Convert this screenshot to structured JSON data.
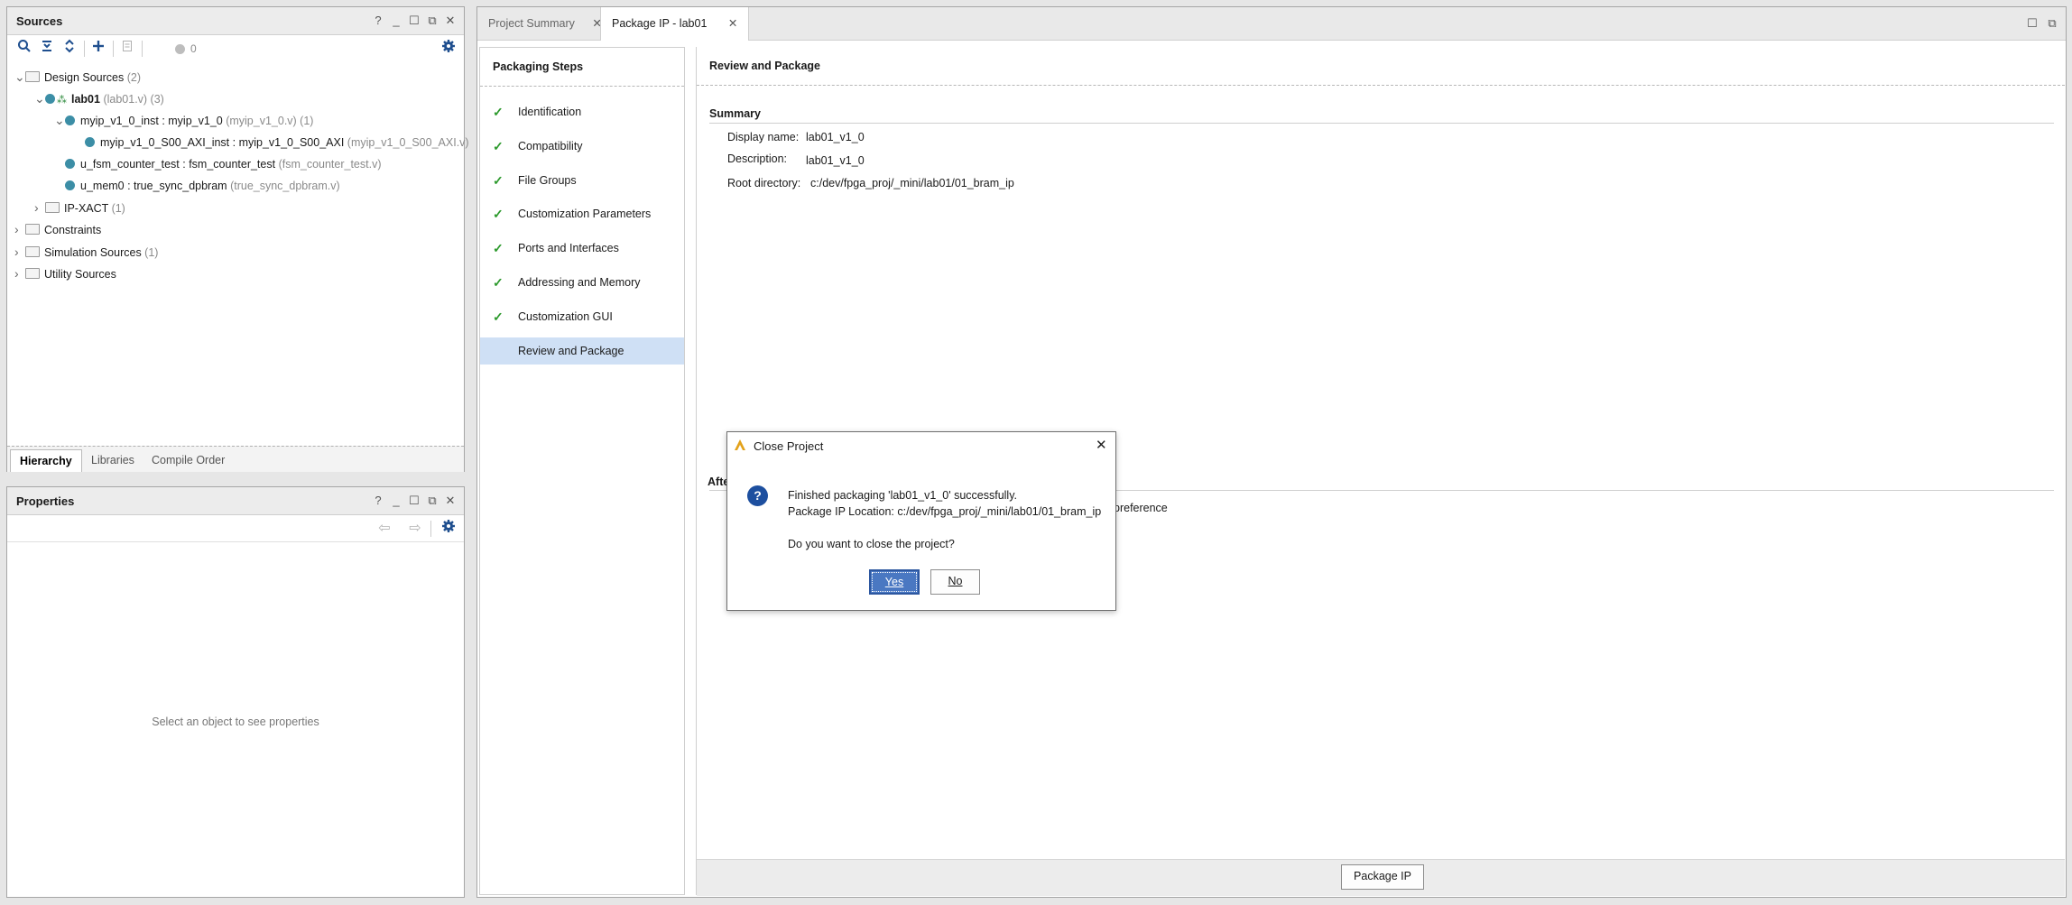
{
  "sources": {
    "title": "Sources",
    "toolbar_badge": "0",
    "tree": [
      {
        "indent": 0,
        "chev": "∨",
        "icon": "folder",
        "name": "Design Sources",
        "muted": " (2)",
        "bold": false
      },
      {
        "indent": 1,
        "chev": "∨",
        "icon": "top",
        "name": "lab01",
        "muted": " (lab01.v) (3)",
        "bold": true
      },
      {
        "indent": 2,
        "chev": "∨",
        "icon": "dot",
        "name": "myip_v1_0_inst : myip_v1_0",
        "muted": " (myip_v1_0.v) (1)",
        "bold": false
      },
      {
        "indent": 3,
        "chev": "",
        "icon": "dot",
        "name": "myip_v1_0_S00_AXI_inst : myip_v1_0_S00_AXI",
        "muted": " (myip_v1_0_S00_AXI.v)",
        "bold": false
      },
      {
        "indent": 2,
        "chev": "",
        "icon": "dot",
        "name": "u_fsm_counter_test : fsm_counter_test",
        "muted": " (fsm_counter_test.v)",
        "bold": false
      },
      {
        "indent": 2,
        "chev": "",
        "icon": "dot",
        "name": "u_mem0 : true_sync_dpbram",
        "muted": " (true_sync_dpbram.v)",
        "bold": false
      },
      {
        "indent": 1,
        "chev": ">",
        "icon": "folder",
        "name": "IP-XACT",
        "muted": " (1)",
        "bold": false
      },
      {
        "indent": 0,
        "chev": ">",
        "icon": "folder",
        "name": "Constraints",
        "muted": "",
        "bold": false
      },
      {
        "indent": 0,
        "chev": ">",
        "icon": "folder",
        "name": "Simulation Sources",
        "muted": " (1)",
        "bold": false
      },
      {
        "indent": 0,
        "chev": ">",
        "icon": "folder",
        "name": "Utility Sources",
        "muted": "",
        "bold": false
      }
    ],
    "bottom_tabs": [
      "Hierarchy",
      "Libraries",
      "Compile Order"
    ]
  },
  "properties": {
    "title": "Properties",
    "empty_text": "Select an object to see properties"
  },
  "tabs": {
    "project_summary": "Project Summary",
    "package_ip": "Package IP - lab01"
  },
  "steps": {
    "title": "Packaging Steps",
    "items": [
      "Identification",
      "Compatibility",
      "File Groups",
      "Customization Parameters",
      "Ports and Interfaces",
      "Addressing and Memory",
      "Customization GUI",
      "Review and Package"
    ]
  },
  "review": {
    "title": "Review and Package",
    "summary_heading": "Summary",
    "display_name_label": "Display name:",
    "display_name_value": "lab01_v1_0",
    "description_label": "Description:",
    "description_value": "lab01_v1_0",
    "root_dir_label": "Root directory:",
    "root_dir_value": "c:/dev/fpga_proj/_mini/lab01/01_bram_ip",
    "after_heading_partial": "Afte",
    "after_text_partial": "preference",
    "package_button": "Package IP"
  },
  "dialog": {
    "title": "Close Project",
    "line1": "Finished packaging 'lab01_v1_0' successfully.",
    "line2": "Package IP Location: c:/dev/fpga_proj/_mini/lab01/01_bram_ip",
    "question": "Do you want to close the project?",
    "yes": "Yes",
    "no": "No"
  }
}
